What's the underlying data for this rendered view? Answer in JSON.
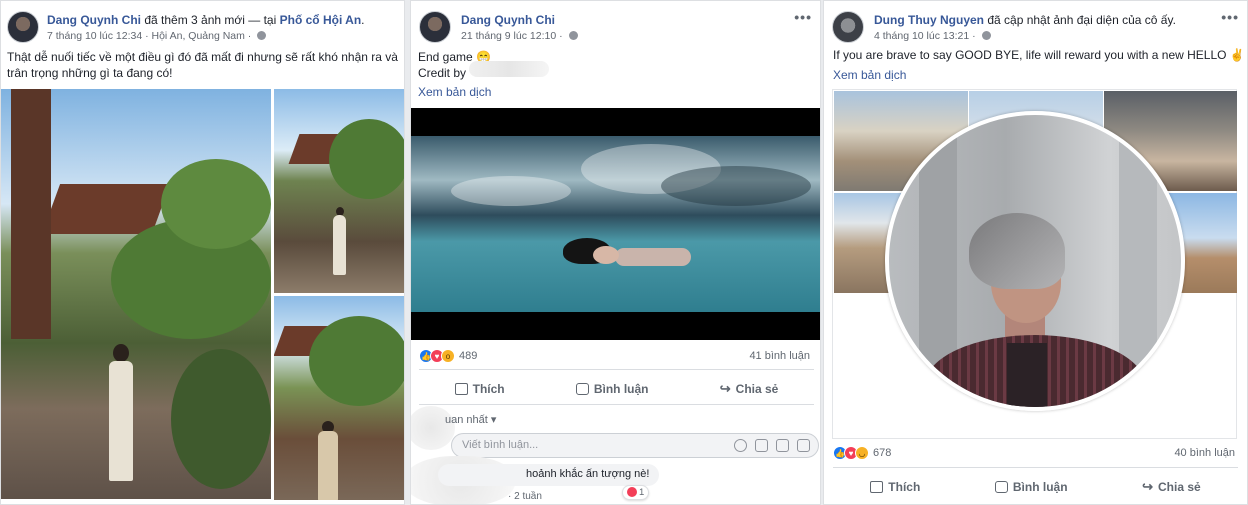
{
  "post1": {
    "author": "Dang Quynh Chi",
    "action": " đã thêm 3 ảnh mới — tại ",
    "place": "Phố cổ Hội An",
    "place_suffix": ".",
    "time": "7 tháng 10 lúc 12:34",
    "location": " · Hội An, Quảng Nam · ",
    "text": "Thật dễ nuối tiếc về một điều gì đó đã mất đi nhưng sẽ rất khó nhận ra và trân trọng những gì ta đang có!"
  },
  "post2": {
    "author": "Dang Quynh Chi",
    "time": "21 tháng 9 lúc 12:10 · ",
    "more": "•••",
    "text_line1": "End game 😁",
    "text_line2": "Credit by",
    "see_translation": "Xem bản dịch",
    "reaction_count": "489",
    "comment_count": "41 bình luận",
    "actions": {
      "like": "Thích",
      "comment": "Bình luận",
      "share": "Chia sẻ"
    },
    "sort_label": "uan nhất ▾",
    "comment_placeholder": "Viết bình luận...",
    "comment_text": "hoảnh khắc ấn tượng nè!",
    "comment_meta": "· 2 tuần",
    "comment_reactions": "1"
  },
  "post3": {
    "author": "Dung Thuy Nguyen",
    "action": " đã cập nhật ảnh đại diện của cô ấy.",
    "time": "4 tháng 10 lúc 13:21 · ",
    "more": "•••",
    "text": "If you are brave to say GOOD BYE, life will reward you with a new HELLO ✌",
    "see_translation": "Xem bản dịch",
    "reaction_count": "678",
    "comment_count": "40 bình luận",
    "actions": {
      "like": "Thích",
      "comment": "Bình luận",
      "share": "Chia sẻ"
    }
  },
  "colors": {
    "link": "#385898",
    "like": "#1877f2",
    "love": "#f33e58",
    "haha": "#f7b125"
  },
  "icons": [
    "globe-icon",
    "like-icon",
    "love-icon",
    "wow-icon",
    "haha-icon",
    "thumb-icon",
    "comment-icon",
    "share-icon",
    "emoji-icon",
    "camera-icon",
    "gif-icon",
    "sticker-icon",
    "more-icon"
  ]
}
